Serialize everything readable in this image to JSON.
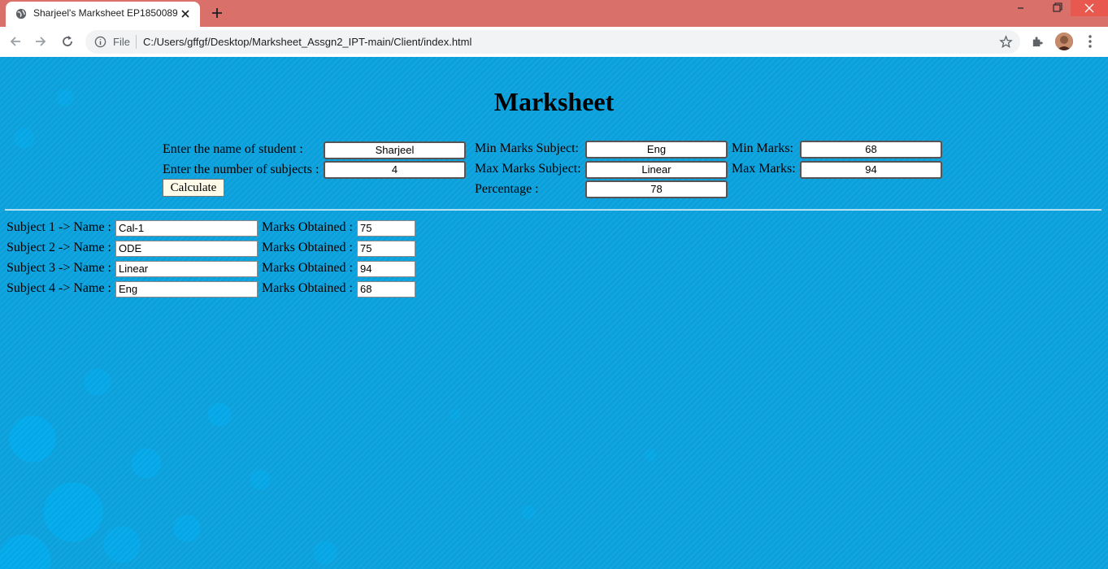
{
  "browser": {
    "tab_title": "Sharjeel's Marksheet EP1850089",
    "scheme_label": "File",
    "url": "C:/Users/gffgf/Desktop/Marksheet_Assgn2_IPT-main/Client/index.html"
  },
  "page": {
    "title": "Marksheet",
    "student_name_label": "Enter the name of student :",
    "student_name_value": "Sharjeel",
    "subjects_count_label": "Enter the number of subjects :",
    "subjects_count_value": "4",
    "calculate_label": "Calculate",
    "min_subject_label": "Min Marks Subject:",
    "min_subject_value": "Eng",
    "max_subject_label": "Max Marks Subject:",
    "max_subject_value": "Linear",
    "percentage_label": "Percentage :",
    "percentage_value": "78",
    "min_marks_label": "Min Marks:",
    "min_marks_value": "68",
    "max_marks_label": "Max Marks:",
    "max_marks_value": "94"
  },
  "subjects": [
    {
      "label": "Subject 1 -> Name :",
      "name": "Cal-1",
      "marks_label": "Marks Obtained :",
      "marks": "75"
    },
    {
      "label": "Subject 2 -> Name :",
      "name": "ODE",
      "marks_label": "Marks Obtained :",
      "marks": "75"
    },
    {
      "label": "Subject 3 -> Name :",
      "name": "Linear",
      "marks_label": "Marks Obtained :",
      "marks": "94"
    },
    {
      "label": "Subject 4 -> Name :",
      "name": "Eng",
      "marks_label": "Marks Obtained :",
      "marks": "68"
    }
  ],
  "colors": {
    "tabbar": "#d9706a",
    "page_background": "#0aa0dc",
    "button_background": "#fefce8"
  }
}
